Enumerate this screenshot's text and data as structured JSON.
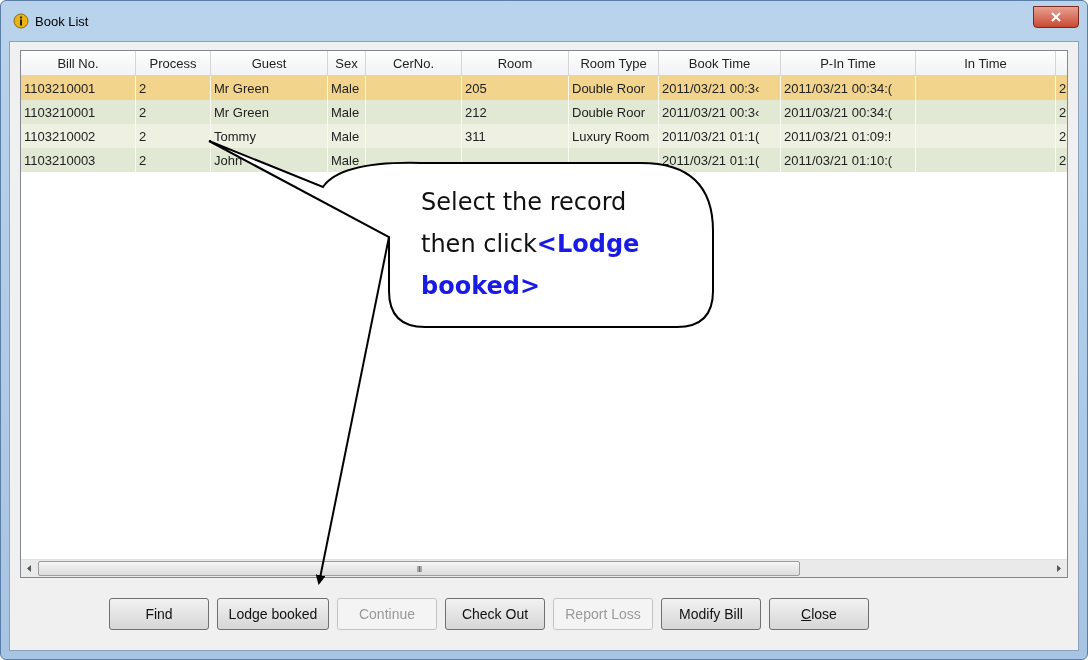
{
  "window": {
    "title": "Book List"
  },
  "table": {
    "columns": [
      "Bill No.",
      "Process",
      "Guest",
      "Sex",
      "CerNo.",
      "Room",
      "Room Type",
      "Book Time",
      "P-In Time",
      "In Time"
    ],
    "rows": [
      {
        "selected": true,
        "cells": [
          "1103210001",
          "2",
          "Mr Green",
          "Male",
          null,
          "205",
          "Double Roor",
          "2011/03/21 00:3‹",
          "2011/03/21 00:34:(",
          null,
          "2"
        ]
      },
      {
        "selected": false,
        "cells": [
          "1103210001",
          "2",
          "Mr Green",
          "Male",
          null,
          "212",
          "Double Roor",
          "2011/03/21 00:3‹",
          "2011/03/21 00:34:(",
          null,
          "2"
        ]
      },
      {
        "selected": false,
        "cells": [
          "1103210002",
          "2",
          "Tommy",
          "Male",
          null,
          "311",
          "Luxury Room",
          "2011/03/21 01:1(",
          "2011/03/21 01:09:!",
          null,
          "2"
        ]
      },
      {
        "selected": false,
        "cells": [
          "1103210003",
          "2",
          "John",
          "Male",
          null,
          null,
          null,
          "2011/03/21 01:1(",
          "2011/03/21 01:10:(",
          null,
          "2"
        ]
      }
    ]
  },
  "scrollbar_grip": "III",
  "buttons": [
    {
      "label": "Find",
      "disabled": false,
      "mnemonic": false
    },
    {
      "label": "Lodge booked",
      "disabled": false,
      "mnemonic": false
    },
    {
      "label": "Continue",
      "disabled": true,
      "mnemonic": false
    },
    {
      "label": "Check Out",
      "disabled": false,
      "mnemonic": false
    },
    {
      "label": "Report Loss",
      "disabled": true,
      "mnemonic": false
    },
    {
      "label": "Modify Bill",
      "disabled": false,
      "mnemonic": false
    },
    {
      "label": "Close",
      "disabled": false,
      "mnemonic": true
    }
  ],
  "callout": {
    "text": "Select the record then click**<Lodge booked>**"
  }
}
